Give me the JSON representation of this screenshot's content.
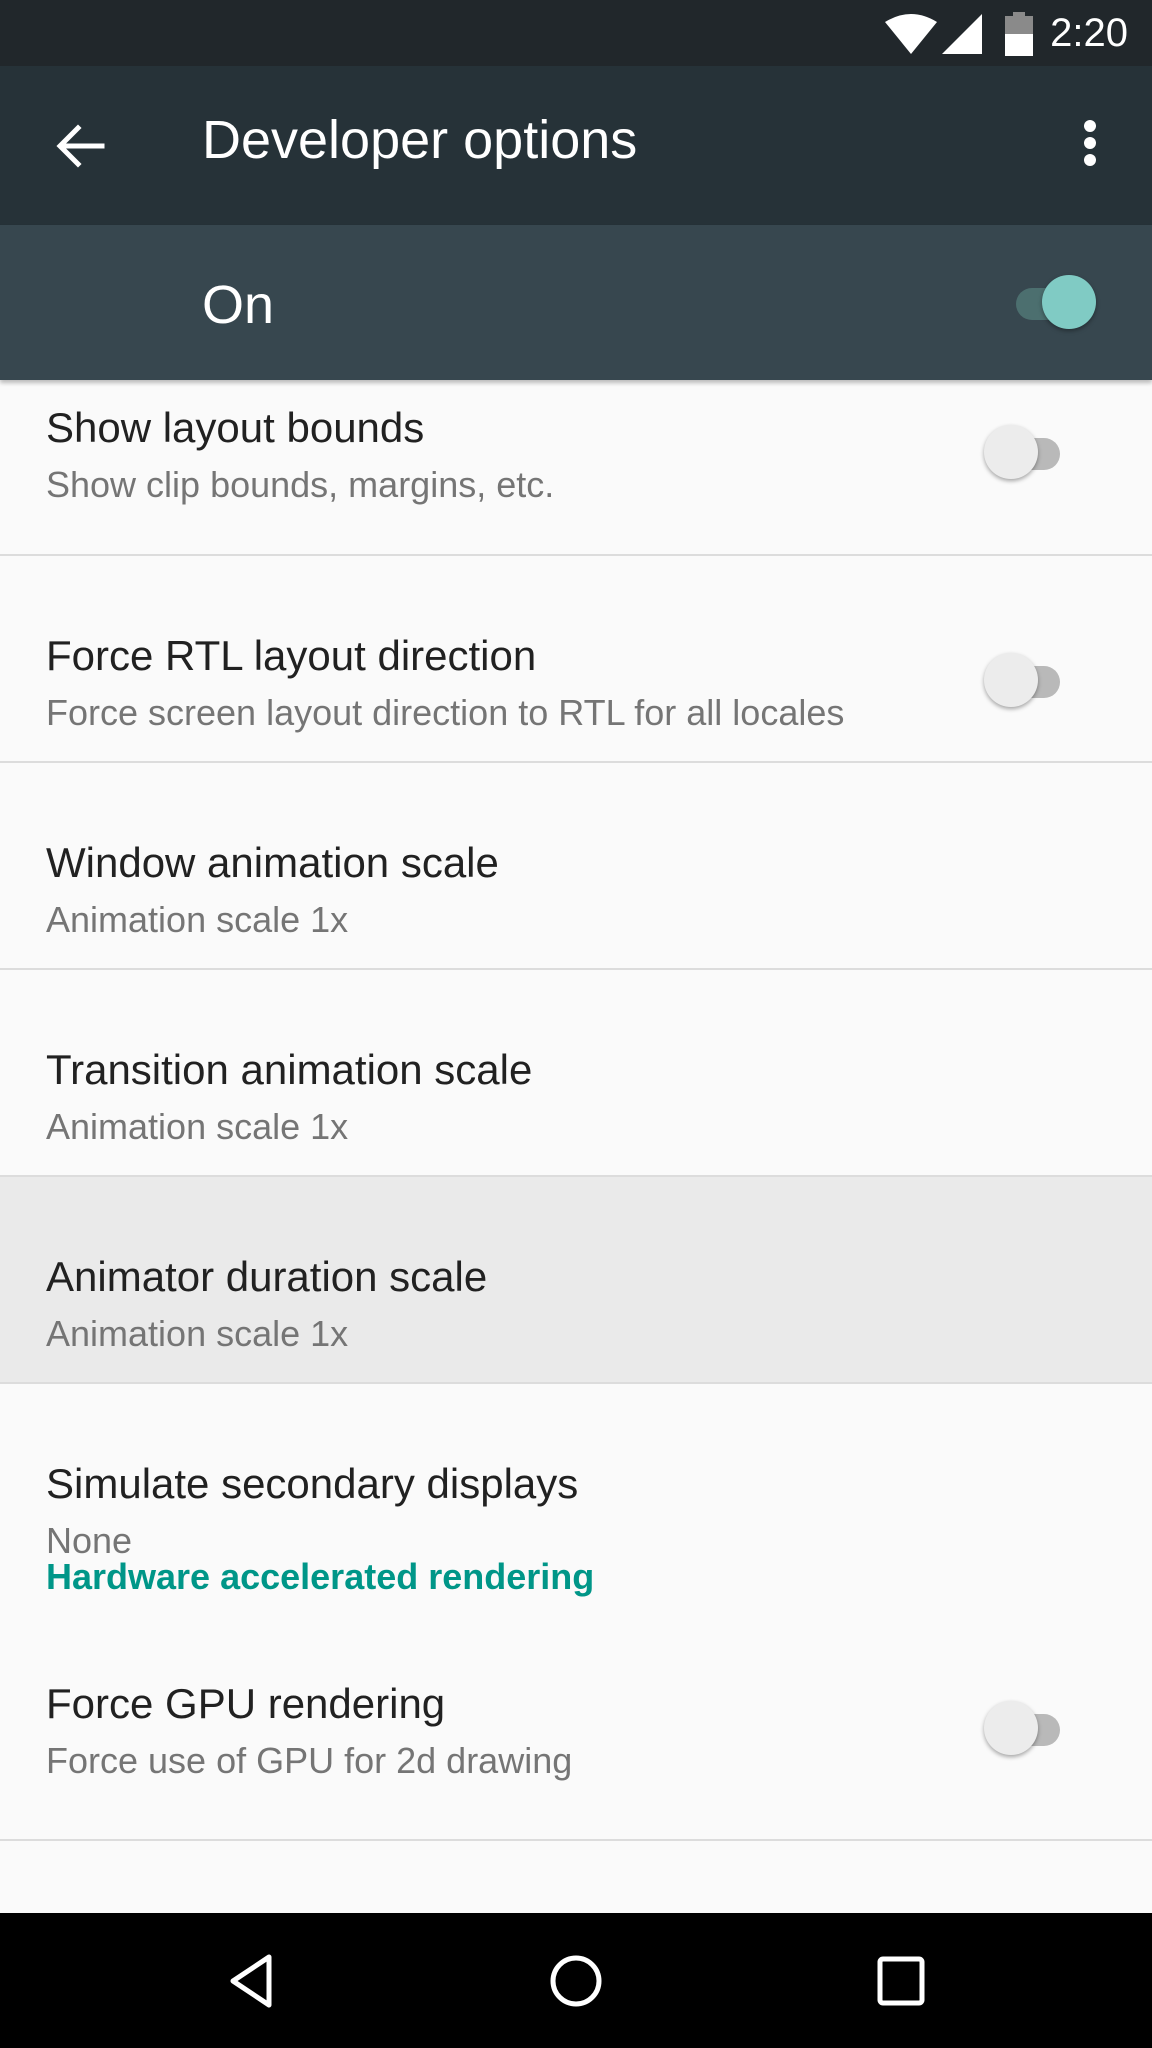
{
  "status_bar": {
    "time": "2:20",
    "icons": [
      "wifi-icon",
      "cell-signal-icon",
      "battery-icon"
    ]
  },
  "toolbar": {
    "back_icon": "arrow-back-icon",
    "title": "Developer options",
    "more_icon": "more-vert-icon"
  },
  "master_switch": {
    "label": "On",
    "checked": true,
    "accent": "#80cbc4"
  },
  "settings": [
    {
      "title": "Show layout bounds",
      "summary": "Show clip bounds, margins, etc.",
      "toggle": false
    },
    {
      "title": "Force RTL layout direction",
      "summary": "Force screen layout direction to RTL for all locales",
      "toggle": false
    },
    {
      "title": "Window animation scale",
      "summary": "Animation scale 1x"
    },
    {
      "title": "Transition animation scale",
      "summary": "Animation scale 1x"
    },
    {
      "title": "Animator duration scale",
      "summary": "Animation scale 1x",
      "pressed": true
    },
    {
      "title": "Simulate secondary displays",
      "summary": "None"
    }
  ],
  "category": {
    "title": "Hardware accelerated rendering",
    "color": "#009688"
  },
  "hw_settings": [
    {
      "title": "Force GPU rendering",
      "summary": "Force use of GPU for 2d drawing",
      "toggle": false
    }
  ],
  "nav_bar": {
    "buttons": [
      "back-icon",
      "home-icon",
      "recents-icon"
    ]
  }
}
